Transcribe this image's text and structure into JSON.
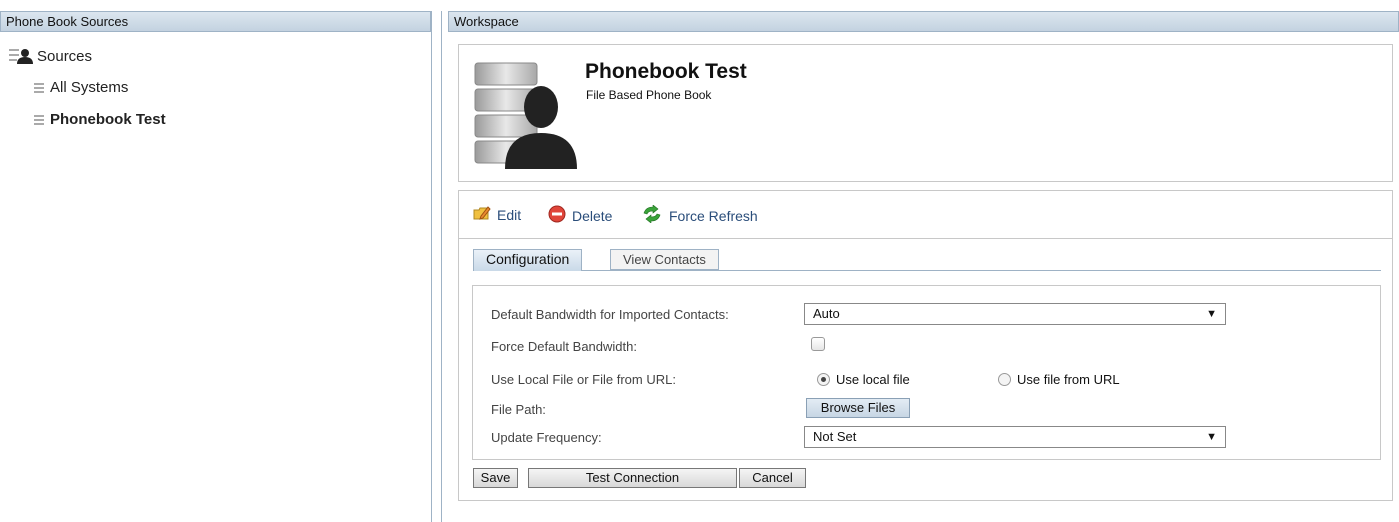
{
  "left_panel": {
    "header": "Phone Book Sources",
    "root_label": "Sources",
    "items": [
      {
        "label": "All Systems",
        "selected": false
      },
      {
        "label": "Phonebook Test",
        "selected": true
      }
    ]
  },
  "workspace": {
    "header": "Workspace",
    "title": "Phonebook Test",
    "subtitle": "File Based Phone Book",
    "toolbar": {
      "edit_label": "Edit",
      "delete_label": "Delete",
      "refresh_label": "Force Refresh"
    },
    "tabs": [
      {
        "label": "Configuration",
        "active": true
      },
      {
        "label": "View Contacts",
        "active": false
      }
    ],
    "form": {
      "bandwidth_label": "Default Bandwidth for Imported Contacts:",
      "bandwidth_value": "Auto",
      "force_label": "Force Default Bandwidth:",
      "force_checked": false,
      "source_label": "Use Local File or File from URL:",
      "radio_local": "Use local file",
      "radio_url": "Use file from URL",
      "selected_source": "local",
      "path_label": "File Path:",
      "browse_label": "Browse Files",
      "frequency_label": "Update Frequency:",
      "frequency_value": "Not Set"
    },
    "buttons": {
      "save": "Save",
      "test": "Test Connection",
      "cancel": "Cancel"
    }
  },
  "colors": {
    "header_bg": "#c3d2e0",
    "link_blue": "#2a4d7a",
    "delete_red": "#e0453a",
    "refresh_green": "#3aa33a"
  }
}
